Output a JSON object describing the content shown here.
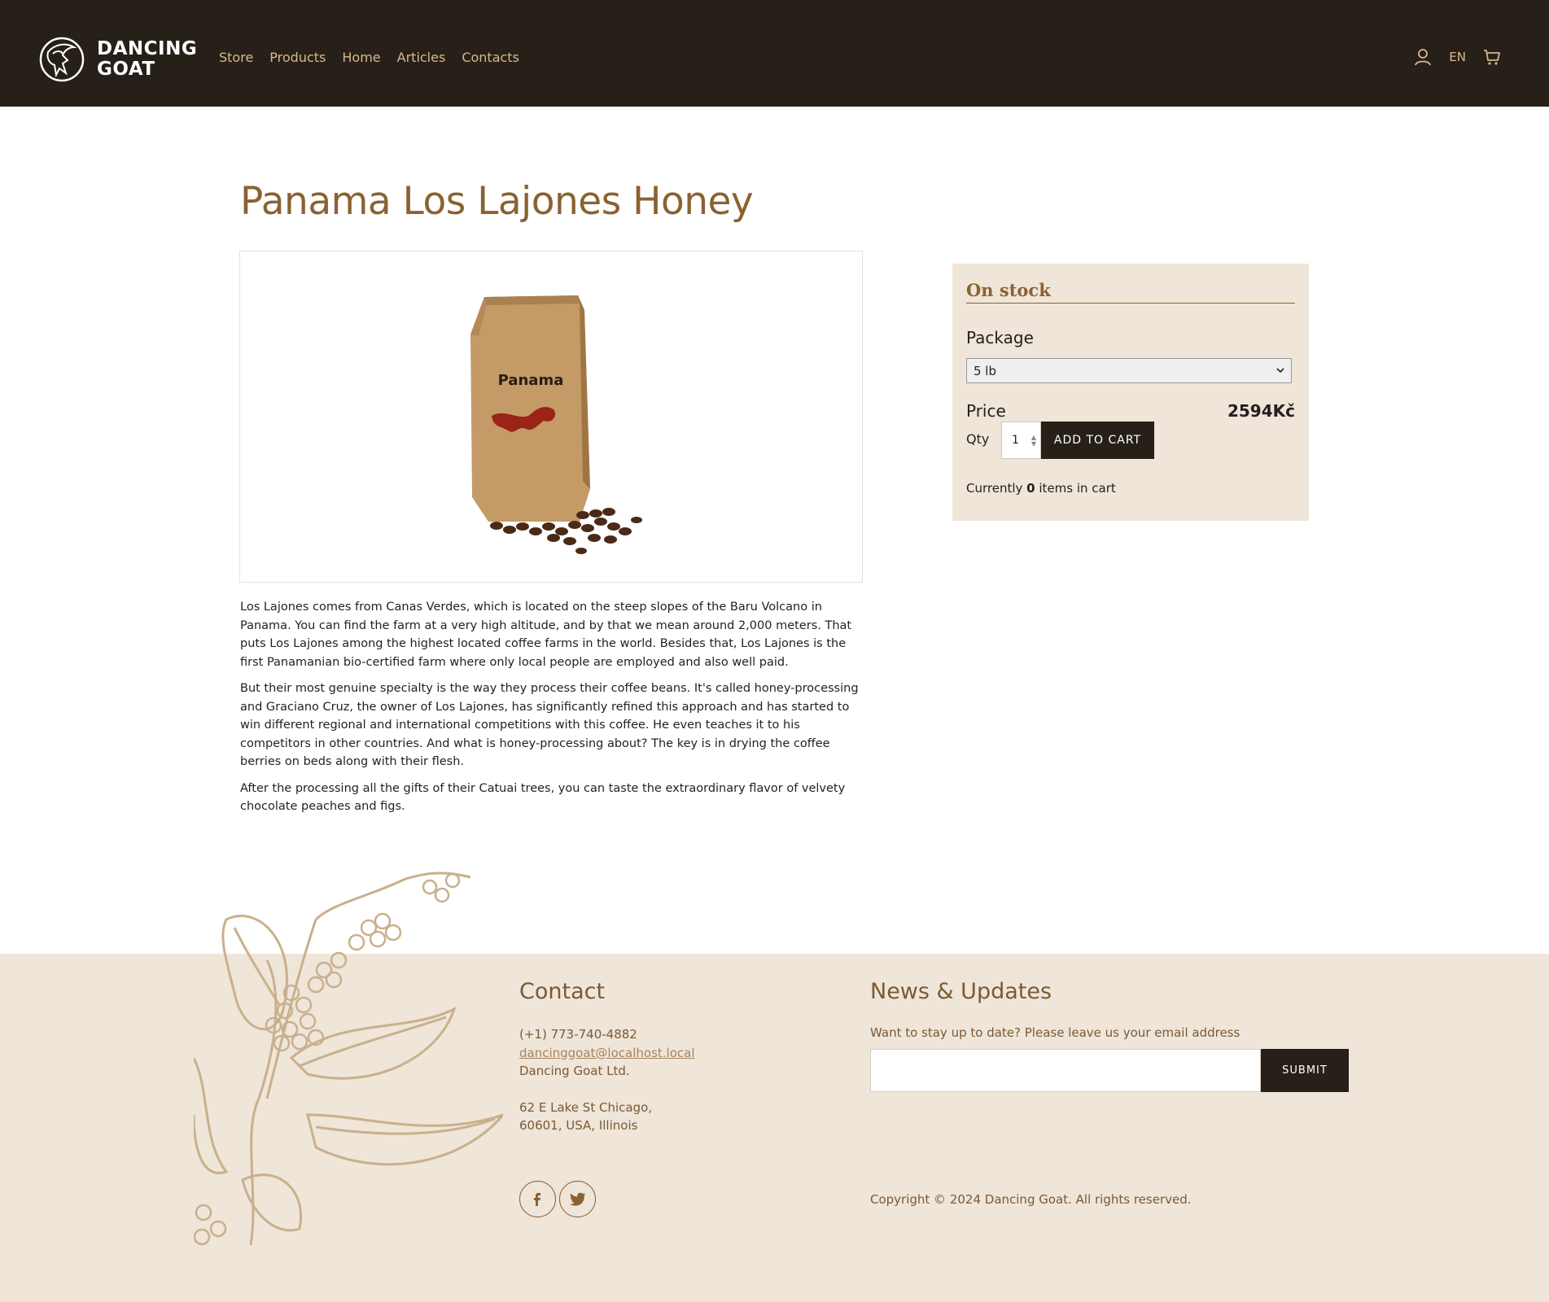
{
  "header": {
    "logo_line1": "DANCING",
    "logo_line2": "GOAT",
    "nav": [
      "Store",
      "Products",
      "Home",
      "Articles",
      "Contacts"
    ],
    "language": "EN",
    "icons": [
      "user-icon",
      "cart-icon"
    ]
  },
  "product": {
    "title": "Panama Los Lajones Honey",
    "bag_label": "Panama",
    "description": [
      "Los Lajones comes from Canas Verdes, which is located on the steep slopes of the Baru Volcano in Panama. You can find the farm at a very high altitude, and by that we mean around 2,000 meters. That puts Los Lajones among the highest located coffee farms in the world. Besides that, Los Lajones is the first Panamanian bio-certified farm where only local people are employed and also well paid.",
      "But their most genuine specialty is the way they process their coffee beans. It's called honey-processing and Graciano Cruz, the owner of Los Lajones, has significantly refined this approach and has started to win different regional and international competitions with this coffee. He even teaches it to his competitors in other countries. And what is honey-processing about? The key is in drying the coffee berries on beds along with their flesh.",
      "After the processing all the gifts of their Catuai trees, you can taste the extraordinary flavor of velvety chocolate peaches and figs."
    ]
  },
  "buy_box": {
    "stock_status": "On stock",
    "package_label": "Package",
    "package_selected": "5 lb",
    "price_label": "Price",
    "price_value": "2594Kč",
    "qty_label": "Qty",
    "qty_value": "1",
    "add_to_cart": "ADD TO CART",
    "cart_prefix": "Currently",
    "cart_count": "0",
    "cart_suffix": "items in cart"
  },
  "footer": {
    "contact_heading": "Contact",
    "phone": "(+1) 773-740-4882",
    "email": "dancinggoat@localhost.local",
    "company": "Dancing Goat Ltd.",
    "address_line1": "62 E Lake St Chicago,",
    "address_line2": "60601, USA, Illinois",
    "news_heading": "News & Updates",
    "news_text": "Want to stay up to date? Please leave us your email address",
    "submit": "SUBMIT",
    "copyright": "Copyright © 2024 Dancing Goat. All rights reserved.",
    "social_icons": [
      "facebook-icon",
      "twitter-icon"
    ]
  },
  "colors": {
    "header_bg": "#262019",
    "nav_text": "#d8b88c",
    "title": "#8a6232",
    "buy_box_bg": "#efe5d8",
    "footer_bg": "#efe5d9",
    "footer_text": "#7b5a34",
    "button_bg": "#262019"
  }
}
